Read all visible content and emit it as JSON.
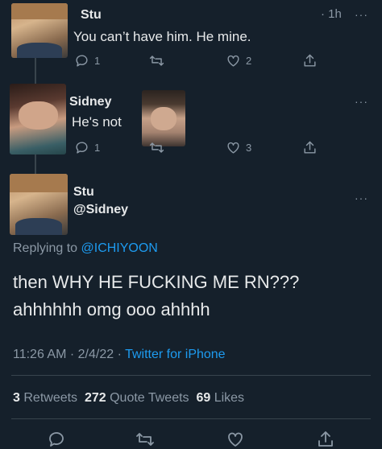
{
  "tweet1": {
    "name": "Stu",
    "time": "· 1h",
    "more": "···",
    "text": "You can’t have him. He mine.",
    "replies": "1",
    "likes": "2"
  },
  "tweet2": {
    "name": "Sidney",
    "more": "···",
    "text": "He's not",
    "replies": "1",
    "likes": "3"
  },
  "main": {
    "name": "Stu",
    "handle": "@Sidney",
    "more": "···",
    "replying_prefix": "Replying to ",
    "replying_to": "@ICHIYOON",
    "text_line1": "then WHY HE FUCKING ME RN???",
    "text_line2": "ahhhhhh omg ooo ahhhh",
    "time": "11:26 AM",
    "sep1": "·",
    "date": "2/4/22",
    "sep2": "·",
    "source": "Twitter for iPhone",
    "retweets_count": "3",
    "retweets_label": "Retweets",
    "quotes_count": "272",
    "quotes_label": "Quote Tweets",
    "likes_count": "69",
    "likes_label": "Likes"
  },
  "icons": [
    "reply-icon",
    "retweet-icon",
    "like-icon",
    "share-icon",
    "more-icon"
  ]
}
